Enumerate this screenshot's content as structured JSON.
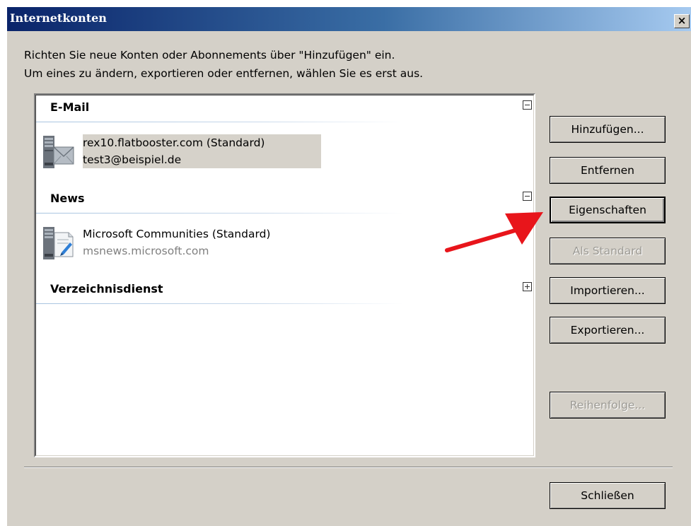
{
  "window": {
    "title": "Internetkonten",
    "close_label": "×"
  },
  "description": {
    "line1": "Richten Sie neue Konten oder Abonnements über \"Hinzufügen\" ein.",
    "line2": "Um eines zu ändern, exportieren oder entfernen, wählen Sie es erst aus."
  },
  "groups": {
    "email": {
      "label": "E-Mail",
      "expanded": true,
      "account": {
        "name": "rex10.flatbooster.com (Standard)",
        "detail": "test3@beispiel.de",
        "icon": "mail-server-icon",
        "selected": true
      }
    },
    "news": {
      "label": "News",
      "expanded": true,
      "account": {
        "name": "Microsoft Communities (Standard)",
        "detail": "msnews.microsoft.com",
        "icon": "news-server-icon",
        "selected": false
      }
    },
    "directory": {
      "label": "Verzeichnisdienst",
      "expanded": false
    }
  },
  "buttons": {
    "add": "Hinzufügen...",
    "remove": "Entfernen",
    "properties": "Eigenschaften",
    "set_default": "Als Standard",
    "import": "Importieren...",
    "export": "Exportieren...",
    "order": "Reihenfolge...",
    "close": "Schließen"
  },
  "colors": {
    "title_start": "#0a246a",
    "title_end": "#a6caf0",
    "dialog_bg": "#d4d0c8",
    "annotation_arrow": "#e8151b"
  }
}
